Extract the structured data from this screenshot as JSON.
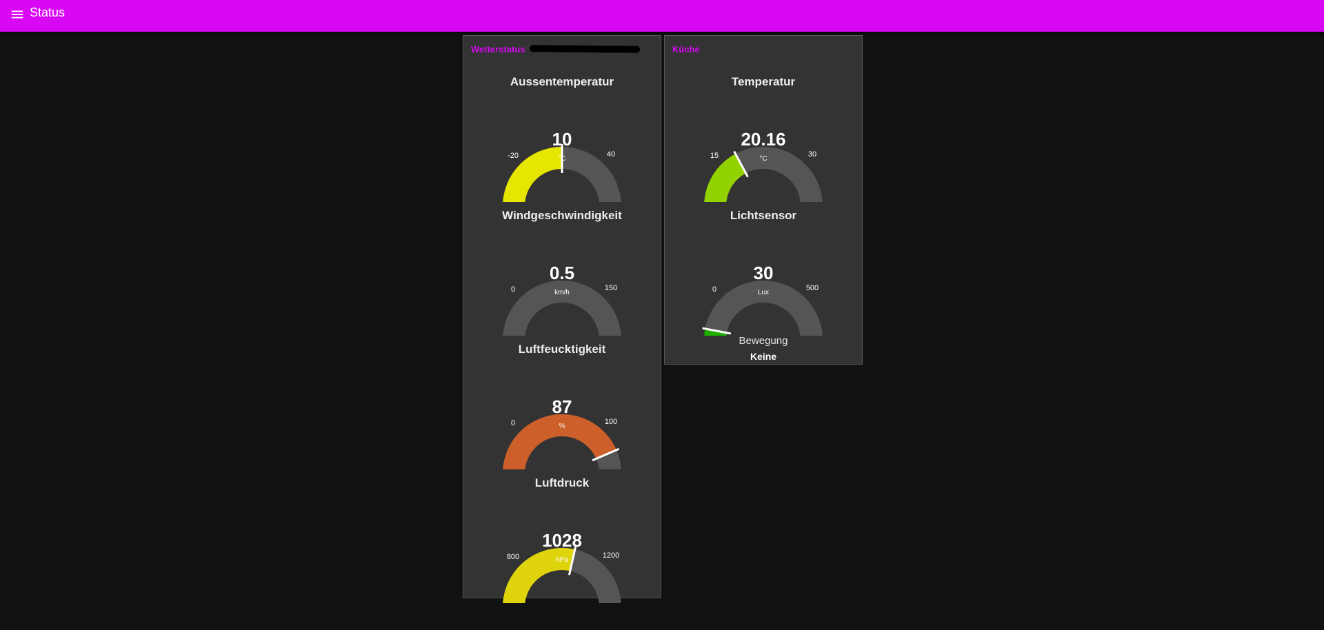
{
  "header": {
    "title": "Status"
  },
  "groups": [
    {
      "title": "Wetterstatus",
      "gauges": [
        {
          "title": "Aussentemperatur",
          "value": "10",
          "unit": "°C",
          "min": "-20",
          "max": "40",
          "num_value": 10,
          "num_min": -20,
          "num_max": 40,
          "color": "#e6e600"
        },
        {
          "title": "Windgeschwindigkeit",
          "value": "0.5",
          "unit": "km/h",
          "min": "0",
          "max": "150",
          "num_value": 0.5,
          "num_min": 0,
          "num_max": 150,
          "color": "#00b500"
        },
        {
          "title": "Luftfeucktigkeit",
          "value": "87",
          "unit": "%",
          "min": "0",
          "max": "100",
          "num_value": 87,
          "num_min": 0,
          "num_max": 100,
          "color": "#cc5f2a"
        },
        {
          "title": "Luftdruck",
          "value": "1028",
          "unit": "hPa",
          "min": "800",
          "max": "1200",
          "num_value": 1028,
          "num_min": 800,
          "num_max": 1200,
          "color": "#dfd40c"
        }
      ]
    },
    {
      "title": "Küche",
      "gauges": [
        {
          "title": "Temperatur",
          "value": "20.16",
          "unit": "°C",
          "min": "15",
          "max": "30",
          "num_value": 20.16,
          "num_min": 15,
          "num_max": 30,
          "color": "#92d200"
        },
        {
          "title": "Lichtsensor",
          "value": "30",
          "unit": "Lux",
          "min": "0",
          "max": "500",
          "num_value": 30,
          "num_min": 0,
          "num_max": 500,
          "color": "#1db000"
        }
      ],
      "text": {
        "label": "Bewegung",
        "value": "Keine"
      }
    }
  ],
  "colors": {
    "accent": "#d808f5",
    "gauge_track": "#555555",
    "group_bg": "#333333",
    "page_bg": "#111111"
  }
}
